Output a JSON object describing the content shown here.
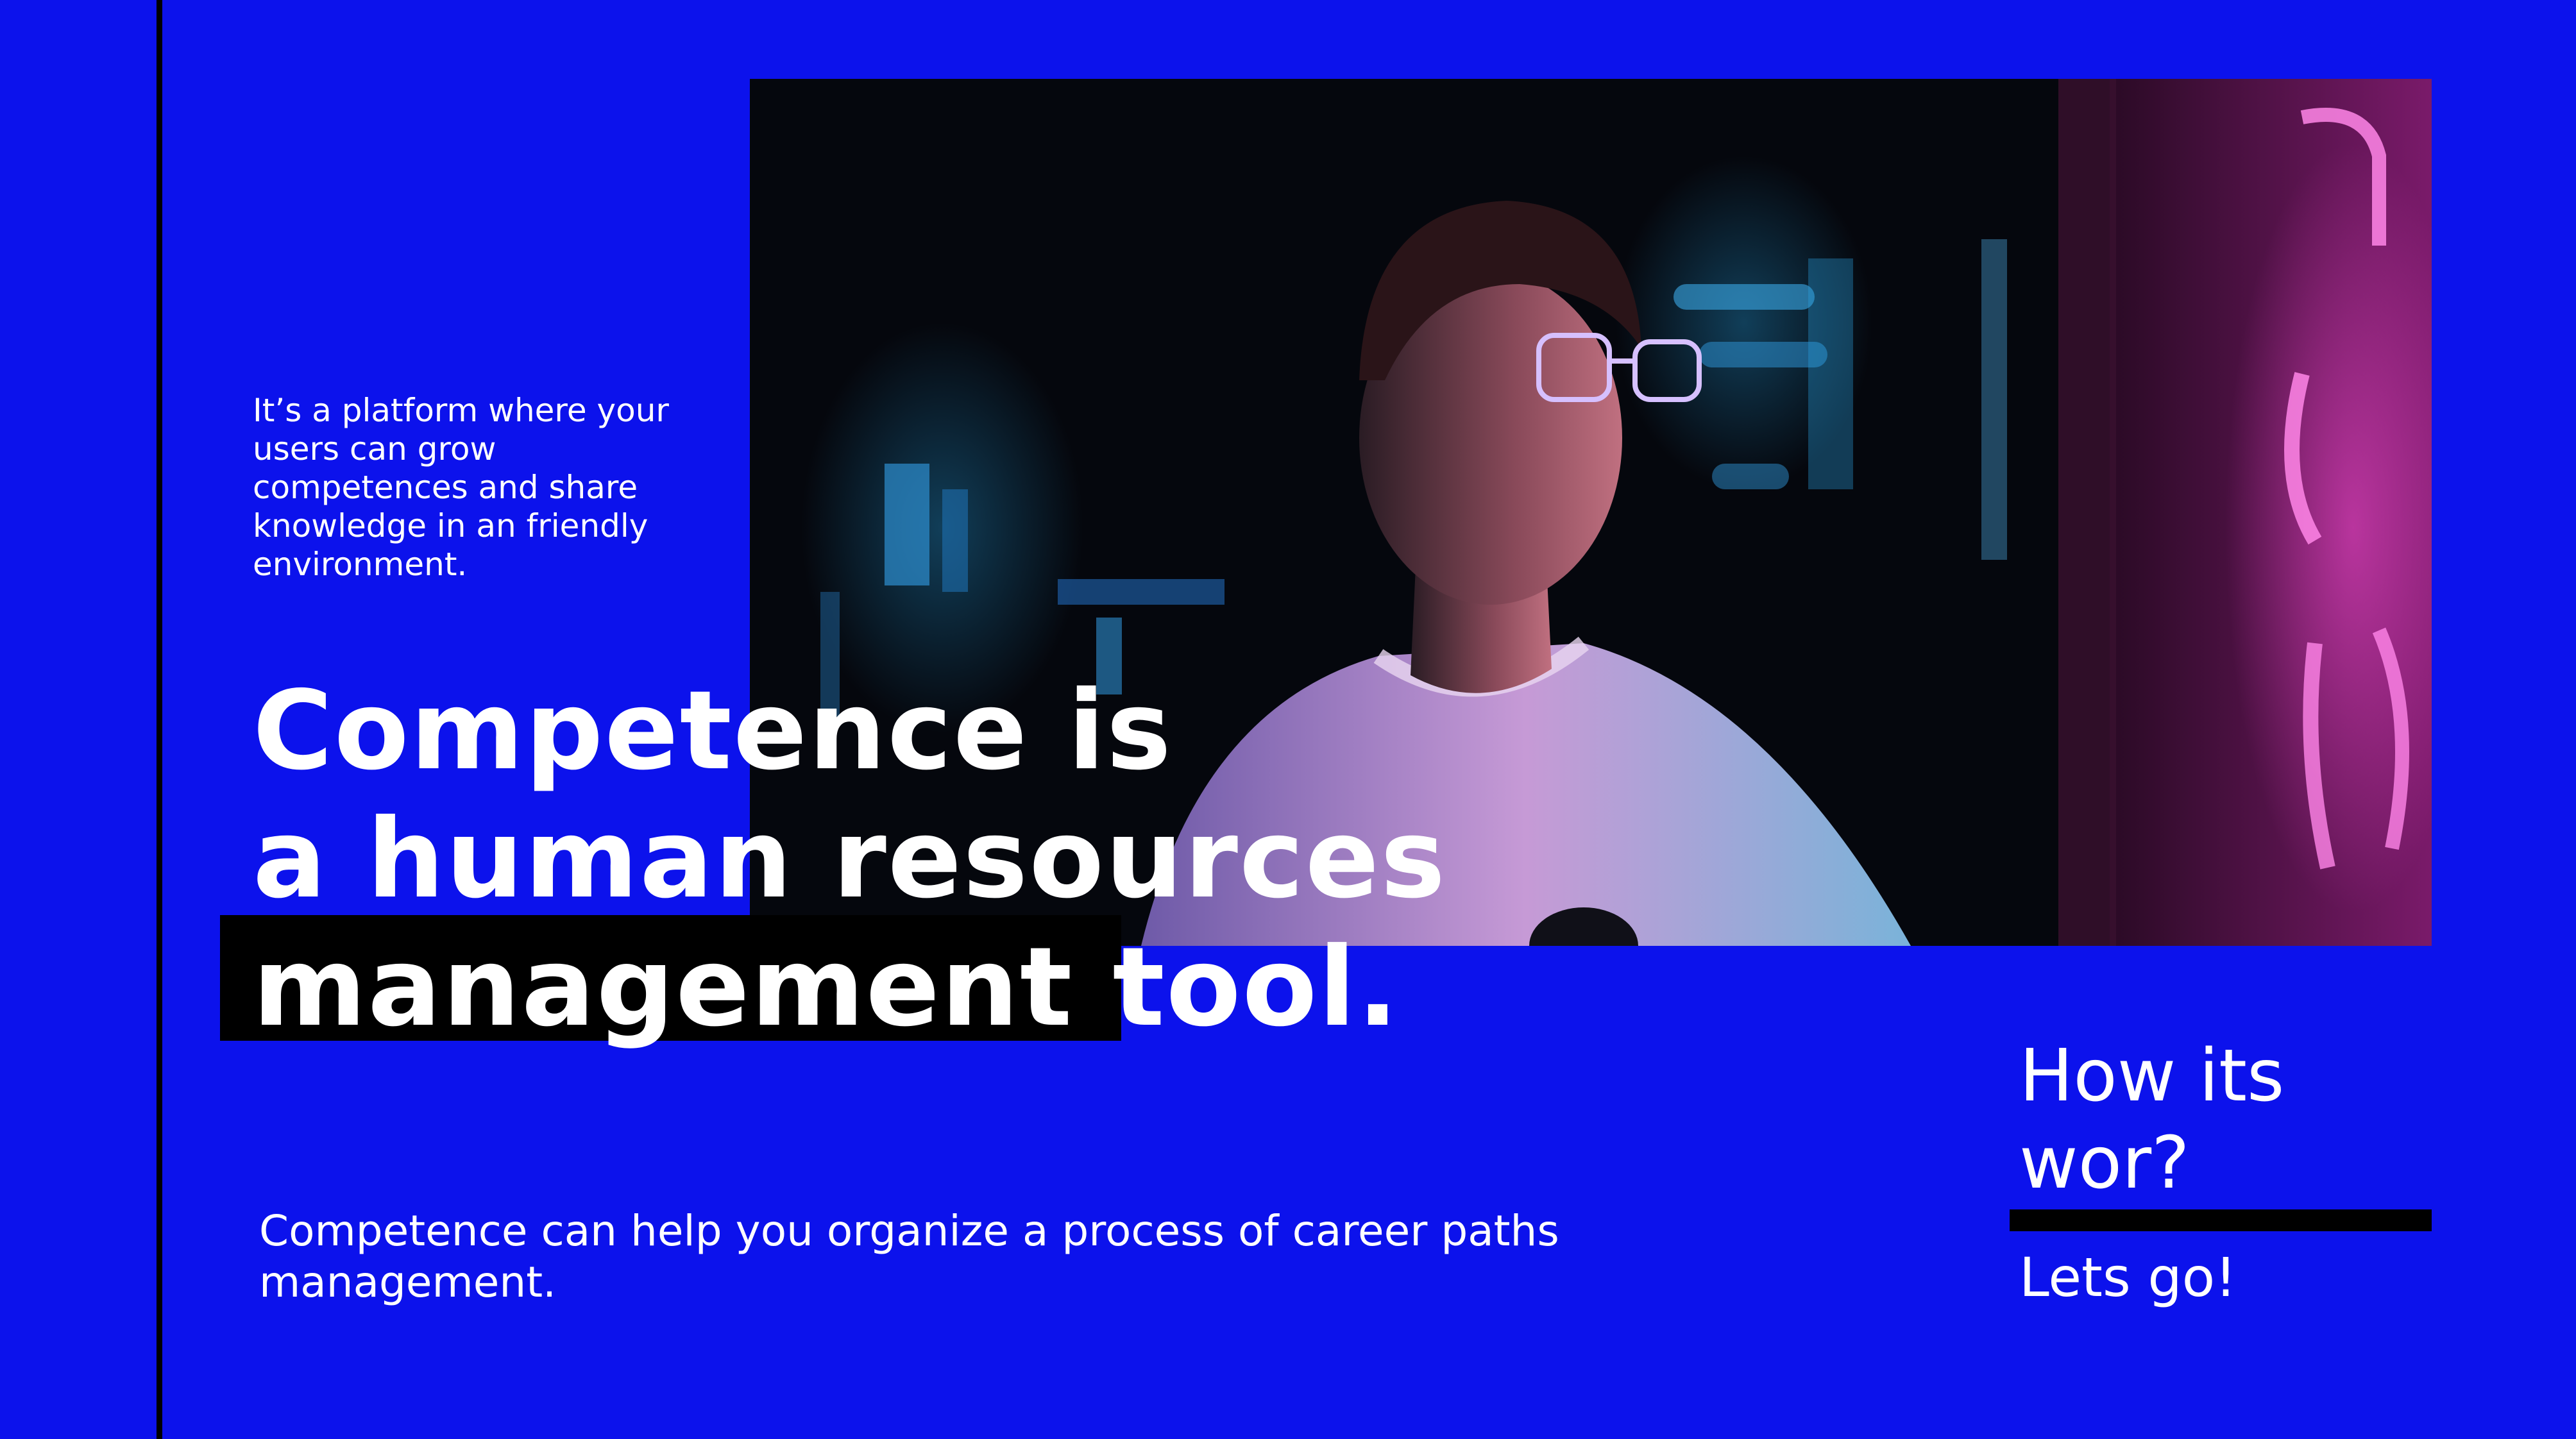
{
  "intro": {
    "text": "It’s a platform where your users can grow competences and share knowledge in an friendly environment."
  },
  "headline": {
    "line1": "Competence is",
    "line2": "a human resources",
    "line3": "management tool."
  },
  "subtext": "Competence can help you organize a process of career paths management.",
  "cta": {
    "title_line1": "How its",
    "title_line2": "wor?",
    "link": "Lets go!"
  },
  "colors": {
    "background": "#0c12ec",
    "accent": "#000000",
    "text": "#ffffff"
  }
}
